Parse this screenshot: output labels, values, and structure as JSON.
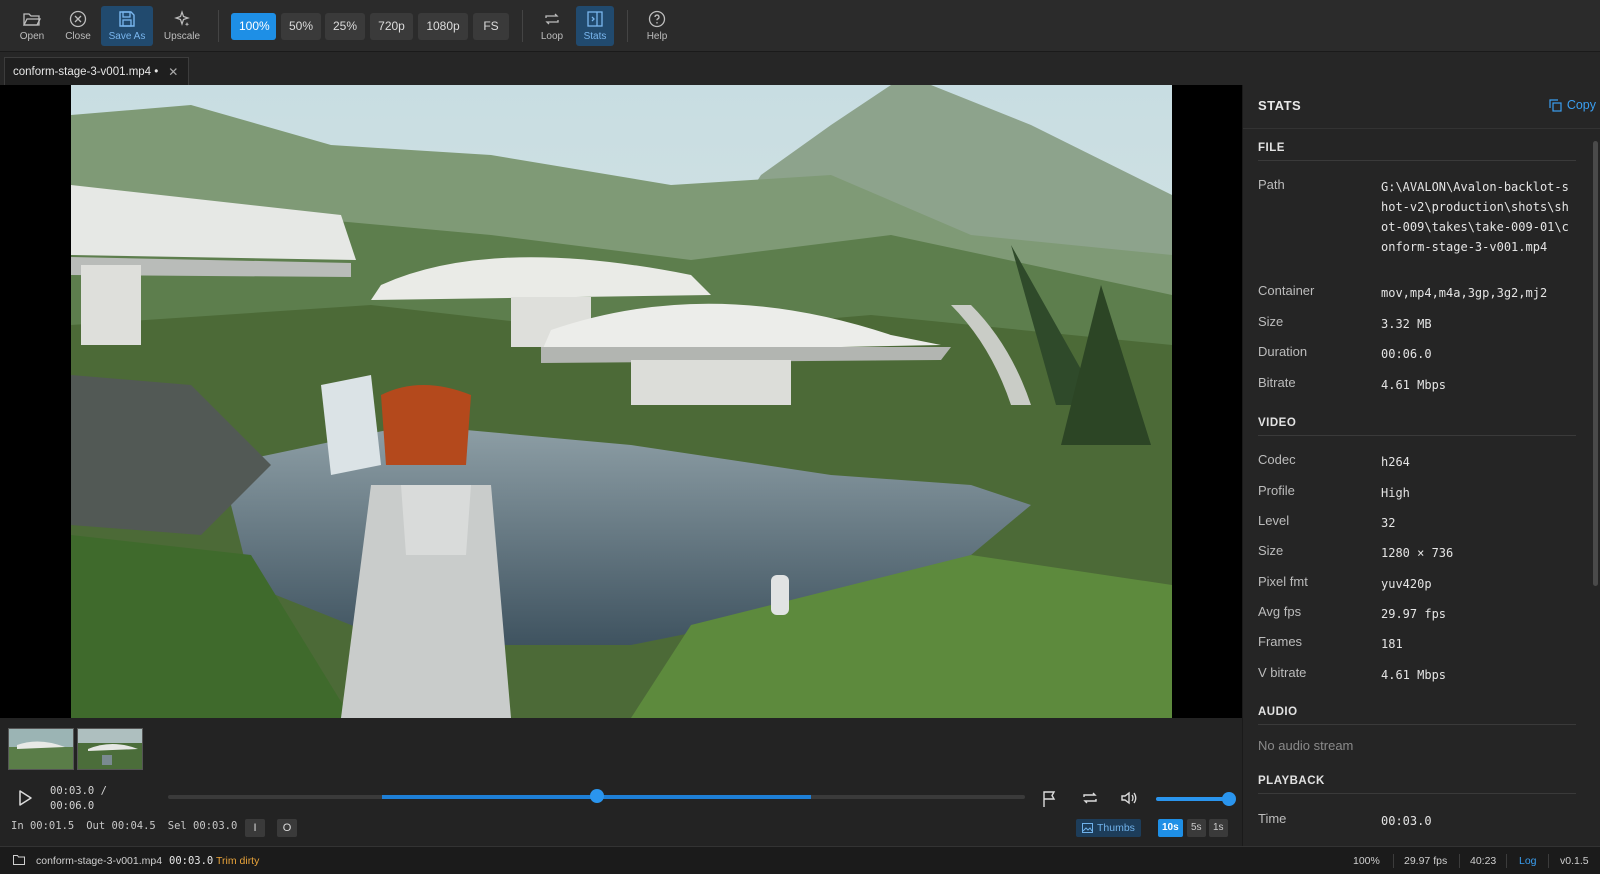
{
  "toolbar": {
    "open_label": "Open",
    "close_label": "Close",
    "saveas_label": "Save As",
    "upscale_label": "Upscale",
    "zoom": [
      "100%",
      "50%",
      "25%",
      "720p",
      "1080p",
      "FS"
    ],
    "active_zoom": "100%",
    "loop_label": "Loop",
    "stats_label": "Stats",
    "help_label": "Help"
  },
  "tab": {
    "title": "conform-stage-3-v001.mp4 •",
    "close_glyph": "✕"
  },
  "player": {
    "time_current": "00:03.0 /",
    "time_total": "00:06.0",
    "in_label": "In 00:01.5",
    "out_label": "Out 00:04.5",
    "sel_label": "Sel 00:03.0",
    "in_btn": "I",
    "out_btn": "O",
    "thumbs_label": "Thumbs",
    "spans": [
      "10s",
      "5s",
      "1s"
    ],
    "active_span": "10s",
    "playhead_fraction": 0.5,
    "selection_in_fraction": 0.25,
    "selection_out_fraction": 0.75,
    "volume_fraction": 1.0
  },
  "stats": {
    "title": "STATS",
    "copy_label": "Copy",
    "file_heading": "FILE",
    "file": [
      {
        "k": "Path",
        "v": "G:\\AVALON\\Avalon-backlot-shot-v2\\production\\shots\\shot-009\\takes\\take-009-01\\conform-stage-3-v001.mp4"
      },
      {
        "k": "Container",
        "v": "mov,mp4,m4a,3gp,3g2,mj2"
      },
      {
        "k": "Size",
        "v": "3.32 MB"
      },
      {
        "k": "Duration",
        "v": "00:06.0"
      },
      {
        "k": "Bitrate",
        "v": "4.61 Mbps"
      }
    ],
    "video_heading": "VIDEO",
    "video": [
      {
        "k": "Codec",
        "v": "h264"
      },
      {
        "k": "Profile",
        "v": "High"
      },
      {
        "k": "Level",
        "v": "32"
      },
      {
        "k": "Size",
        "v": "1280 × 736"
      },
      {
        "k": "Pixel fmt",
        "v": "yuv420p"
      },
      {
        "k": "Avg fps",
        "v": "29.97 fps"
      },
      {
        "k": "Frames",
        "v": "181"
      },
      {
        "k": "V bitrate",
        "v": "4.61 Mbps"
      }
    ],
    "audio_heading": "AUDIO",
    "audio_none": "No audio stream",
    "playback_heading": "PLAYBACK",
    "playback": [
      {
        "k": "Time",
        "v": "00:03.0"
      }
    ]
  },
  "statusbar": {
    "filename": "conform-stage-3-v001.mp4",
    "time": "00:03.0",
    "trim_state": "Trim dirty",
    "zoom": "100%",
    "fps": "29.97 fps",
    "aspect": "40:23",
    "log_label": "Log",
    "version": "v0.1.5"
  },
  "colors": {
    "accent": "#1e8fe6",
    "warning": "#e8a33a",
    "link": "#3a9ef0"
  }
}
